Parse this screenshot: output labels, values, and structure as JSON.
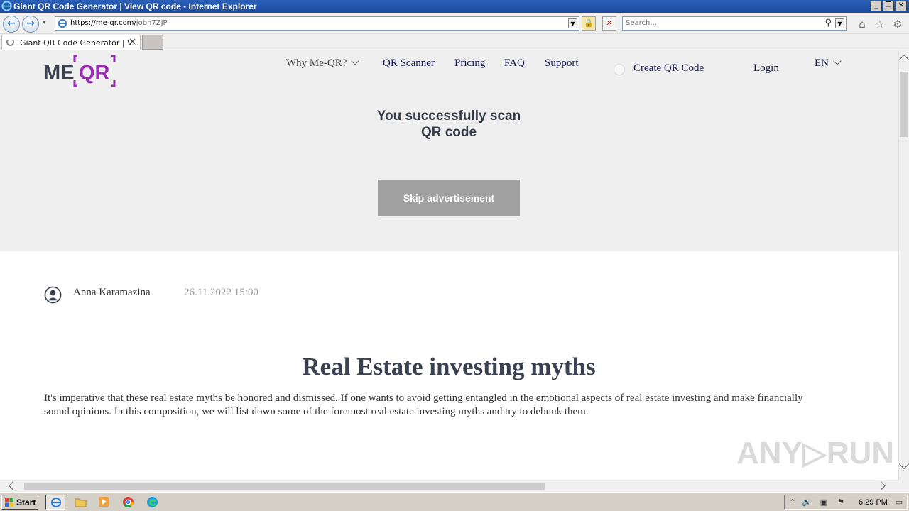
{
  "window": {
    "title": "Giant QR Code Generator | View QR code - Internet Explorer",
    "controls": {
      "minimize": "_",
      "maximize": "❐",
      "close": "✕"
    }
  },
  "browser": {
    "url_host": "https://me-qr.com/",
    "url_path": "jobn7ZJP",
    "search_placeholder": "Search...",
    "tab_title": "Giant QR Code Generator | V...",
    "tab_close": "✕"
  },
  "site": {
    "logo_text": {
      "me": "ME",
      "qr": "QR"
    },
    "nav": {
      "why": "Why Me-QR?",
      "scanner": "QR Scanner",
      "pricing": "Pricing",
      "faq": "FAQ",
      "support": "Support",
      "create": "Create QR Code",
      "login": "Login",
      "lang": "EN"
    },
    "scan_message_line1": "You successfully scan",
    "scan_message_line2": "QR code",
    "skip_button": "Skip advertisement",
    "article": {
      "author": "Anna Karamazina",
      "date": "26.11.2022 15:00",
      "title": "Real Estate investing myths",
      "body": "It's imperative that these real estate myths be honored and dismissed, If one wants to avoid getting entangled in the emotional aspects of real estate investing and make financially sound opinions. In this composition, we will list down some of the foremost real estate investing myths and try to debunk them."
    }
  },
  "watermark": "ANY▷RUN",
  "taskbar": {
    "start": "Start",
    "clock": "6:29 PM"
  },
  "colors": {
    "brand_dark": "#3a4150",
    "brand_accent": "#9b2ab8",
    "nav_text": "#14174d",
    "hero_bg": "#efefef",
    "skip_bg": "#a0a0a0"
  }
}
